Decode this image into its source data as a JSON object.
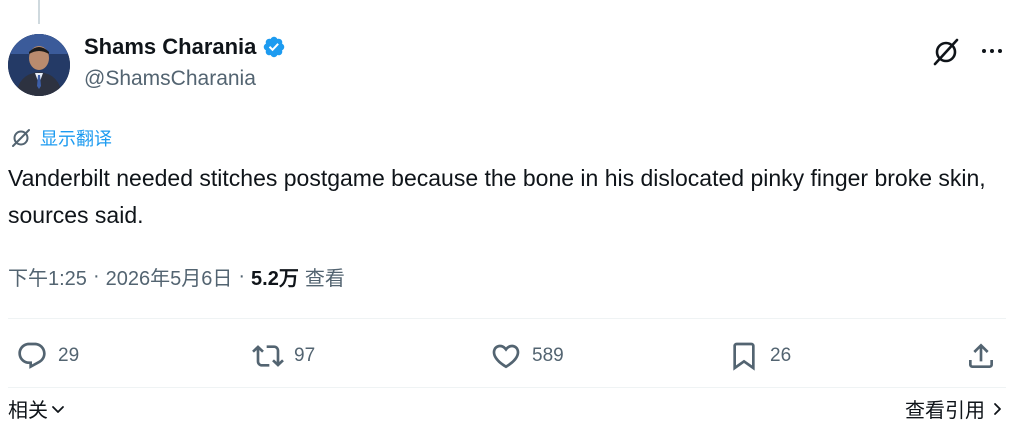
{
  "author": {
    "display_name": "Shams Charania",
    "handle": "@ShamsCharania",
    "verified": true
  },
  "icons": {
    "grok": "grok-icon",
    "more": "more-options-icon",
    "translate": "translate-icon",
    "reply": "reply-icon",
    "retweet": "retweet-icon",
    "like": "heart-icon",
    "bookmark": "bookmark-icon",
    "share": "share-icon"
  },
  "translate_label": "显示翻译",
  "tweet": {
    "text": "Vanderbilt needed stitches postgame because the bone in his dislocated pinky finger broke skin, sources said."
  },
  "meta": {
    "time": "下午1:25",
    "date": "2026年5月6日",
    "views_count": "5.2万",
    "views_label": "查看",
    "separator": "·"
  },
  "actions": {
    "replies": "29",
    "retweets": "97",
    "likes": "589",
    "bookmarks": "26"
  },
  "footer": {
    "related_label": "相关",
    "quotes_label": "查看引用"
  },
  "colors": {
    "accent": "#1d9bf0",
    "text_primary": "#0f1419",
    "text_secondary": "#536471",
    "divider": "#eff3f4"
  }
}
